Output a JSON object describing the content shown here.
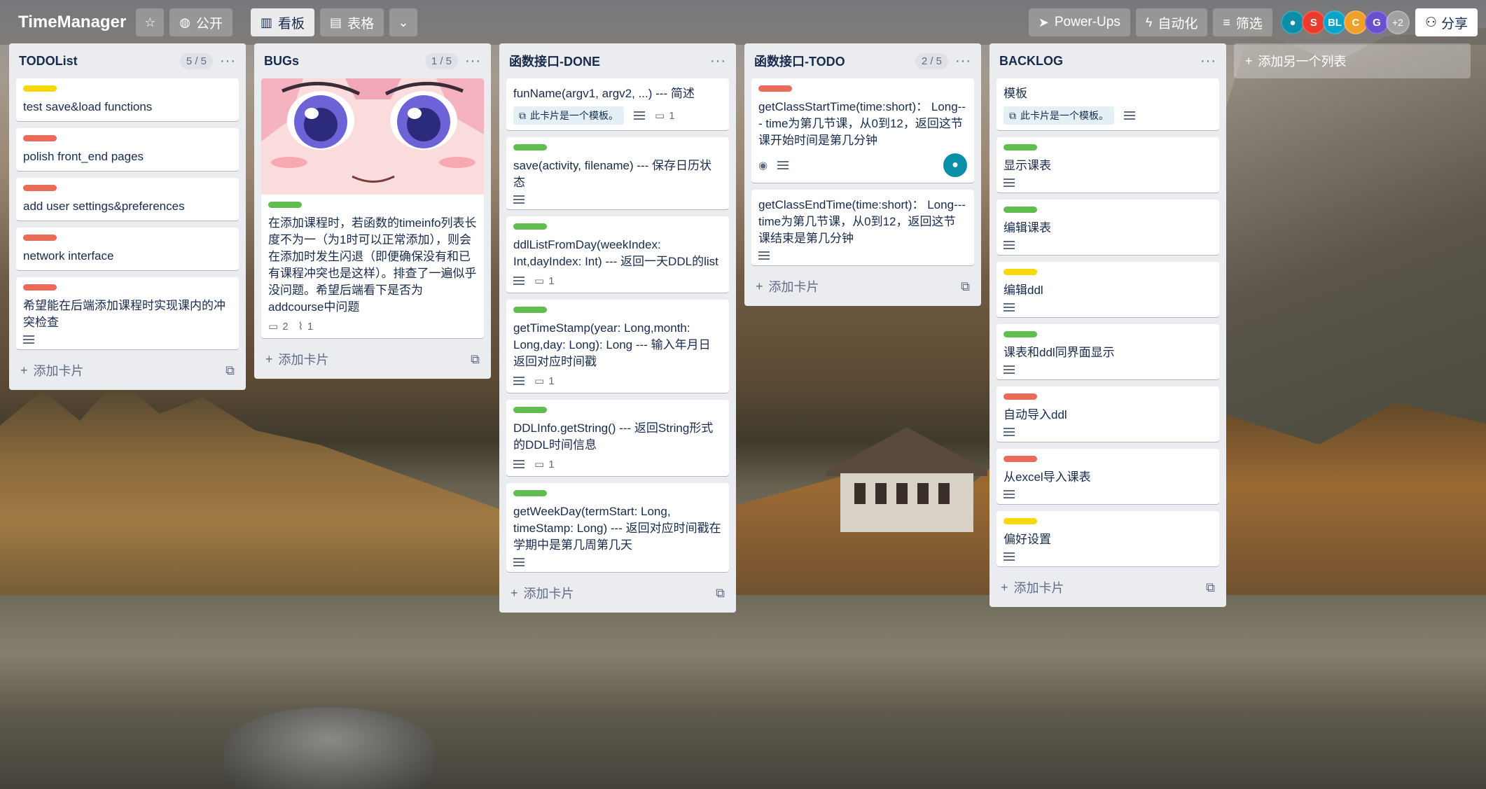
{
  "board": {
    "name": "TimeManager",
    "visibility": "公开",
    "views": {
      "board": "看板",
      "table": "表格"
    },
    "powerups": "Power-Ups",
    "automation": "自动化",
    "filter": "筛选",
    "share": "分享",
    "members": [
      "S",
      "BL",
      "C",
      "G"
    ],
    "members_more": "+2"
  },
  "lists": [
    {
      "title": "TODOList",
      "wip": "5 / 5",
      "cards": [
        {
          "label_color": "#f5d90a",
          "title": "test save&load functions"
        },
        {
          "label_color": "#eb6b5a",
          "title": "polish front_end pages"
        },
        {
          "label_color": "#eb6b5a",
          "title": "add user settings&preferences"
        },
        {
          "label_color": "#eb6b5a",
          "title": "network interface"
        },
        {
          "label_color": "#eb6b5a",
          "title": "希望能在后端添加课程时实现课内的冲突检查"
        }
      ],
      "add_card": "添加卡片"
    },
    {
      "title": "BUGs",
      "wip": "1 / 5",
      "cards": [
        {
          "label_color": "#61bd4f",
          "title": "在添加课程时，若函数的timeinfo列表长度不为一（为1时可以正常添加），则会在添加时发生闪退（即便确保没有和已有课程冲突也是这样）。排查了一遍似乎没问题。希望后端看下是否为addcourse中问题",
          "comments": "2",
          "attachments": "1"
        }
      ],
      "add_card": "添加卡片"
    },
    {
      "title": "函数接口-DONE",
      "cards": [
        {
          "title": "funName(argv1, argv2, ...) --- 简述",
          "template": "此卡片是一个模板。",
          "comments": "1"
        },
        {
          "label_color": "#61bd4f",
          "title": "save(activity, filename) --- 保存日历状态"
        },
        {
          "label_color": "#61bd4f",
          "title": "ddlListFromDay(weekIndex: Int,dayIndex: Int) --- 返回一天DDL的list",
          "comments": "1"
        },
        {
          "label_color": "#61bd4f",
          "title": "getTimeStamp(year: Long,month: Long,day: Long): Long --- 输入年月日返回对应时间戳",
          "comments": "1"
        },
        {
          "label_color": "#61bd4f",
          "title": "DDLInfo.getString() --- 返回String形式的DDL时间信息",
          "comments": "1"
        },
        {
          "label_color": "#61bd4f",
          "title": "getWeekDay(termStart: Long, timeStamp: Long) --- 返回对应时间戳在学期中是第几周第几天"
        }
      ],
      "add_card": "添加卡片"
    },
    {
      "title": "函数接口-TODO",
      "wip": "2 / 5",
      "cards": [
        {
          "label_color": "#eb6b5a",
          "title": "getClassStartTime(time:short)： Long--- time为第几节课，从0到12，返回这节课开始时间是第几分钟"
        },
        {
          "title": "getClassEndTime(time:short)： Long--- time为第几节课，从0到12，返回这节课结束是第几分钟"
        }
      ],
      "add_card": "添加卡片"
    },
    {
      "title": "BACKLOG",
      "cards": [
        {
          "title": "模板",
          "template": "此卡片是一个模板。"
        },
        {
          "label_color": "#61bd4f",
          "title": "显示课表"
        },
        {
          "label_color": "#61bd4f",
          "title": "编辑课表"
        },
        {
          "label_color": "#f5d90a",
          "title": "编辑ddl"
        },
        {
          "label_color": "#61bd4f",
          "title": "课表和ddl同界面显示"
        },
        {
          "label_color": "#eb6b5a",
          "title": "自动导入ddl"
        },
        {
          "label_color": "#eb6b5a",
          "title": "从excel导入课表"
        },
        {
          "label_color": "#f5d90a",
          "title": "偏好设置"
        }
      ],
      "add_card": "添加卡片"
    }
  ],
  "add_list": "添加另一个列表"
}
